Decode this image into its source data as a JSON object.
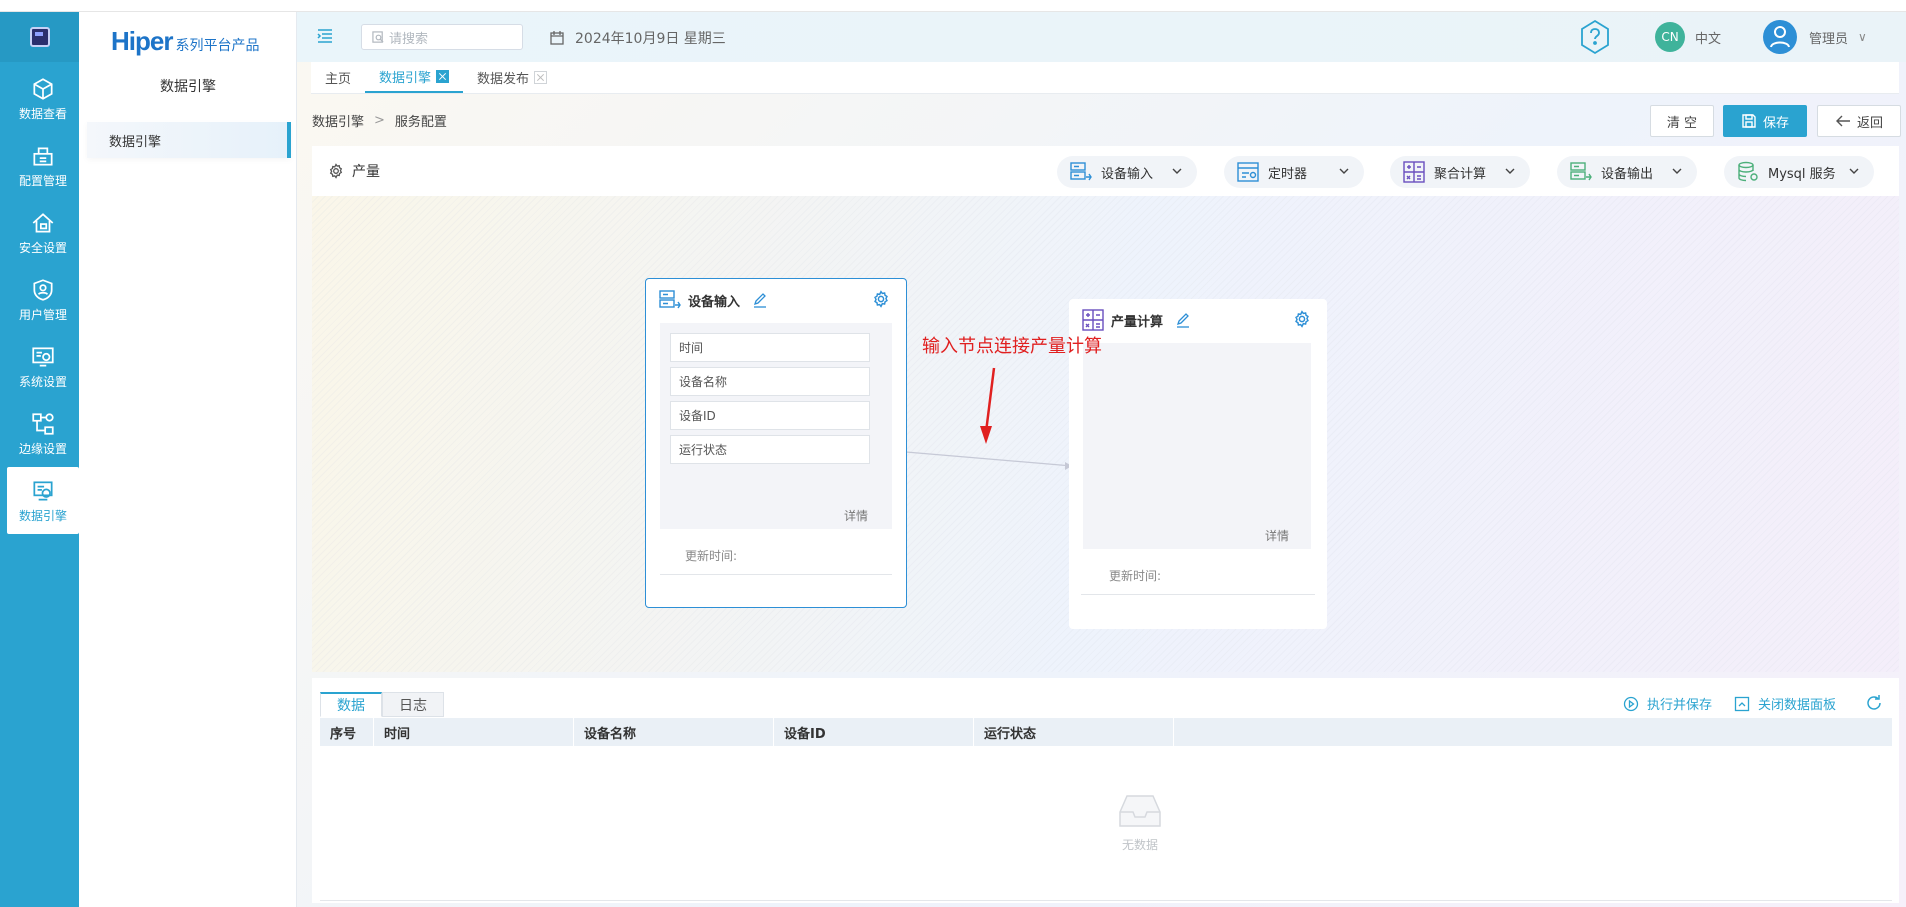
{
  "rail": {
    "items": [
      {
        "label": "数据查看",
        "icon": "cube-icon"
      },
      {
        "label": "配置管理",
        "icon": "config-icon"
      },
      {
        "label": "安全设置",
        "icon": "home-lock-icon"
      },
      {
        "label": "用户管理",
        "icon": "shield-user-icon"
      },
      {
        "label": "系统设置",
        "icon": "system-settings-icon"
      },
      {
        "label": "边缘设置",
        "icon": "edge-icon"
      },
      {
        "label": "数据引擎",
        "icon": "engine-icon"
      }
    ],
    "active_index": 6
  },
  "brand": {
    "name": "Hiper",
    "suffix": "系列平台产品"
  },
  "side2": {
    "title": "数据引擎",
    "menu_item": "数据引擎"
  },
  "header": {
    "search_placeholder": "请搜索",
    "date": "2024年10月9日 星期三",
    "lang_badge": "CN",
    "lang_label": "中文",
    "user_label": "管理员"
  },
  "tabs": [
    {
      "label": "主页",
      "active": false,
      "closable": false
    },
    {
      "label": "数据引擎",
      "active": true,
      "closable": true
    },
    {
      "label": "数据发布",
      "active": false,
      "closable": true
    }
  ],
  "breadcrumb": {
    "root": "数据引擎",
    "sep": ">",
    "current": "服务配置"
  },
  "actions": {
    "clear": "清 空",
    "save": "保存",
    "back": "返回"
  },
  "toolbar": {
    "name": "产量",
    "tools": [
      "设备输入",
      "定时器",
      "聚合计算",
      "设备输出",
      "Mysql 服务"
    ]
  },
  "nodes": {
    "input": {
      "title": "设备输入",
      "fields": [
        "时间",
        "设备名称",
        "设备ID",
        "运行状态"
      ],
      "detail": "详情",
      "update_label": "更新时间:"
    },
    "calc": {
      "title": "产量计算",
      "detail": "详情",
      "update_label": "更新时间:"
    }
  },
  "annotation": "输入节点连接产量计算",
  "bottom": {
    "tabs": [
      "数据",
      "日志"
    ],
    "run_save": "执行并保存",
    "close_panel": "关闭数据面板",
    "columns": [
      "序号",
      "时间",
      "设备名称",
      "设备ID",
      "运行状态"
    ],
    "empty": "无数据"
  },
  "colors": {
    "accent": "#2aa3d0",
    "annotation": "#e02020",
    "node_border": "#2d8fd6"
  }
}
